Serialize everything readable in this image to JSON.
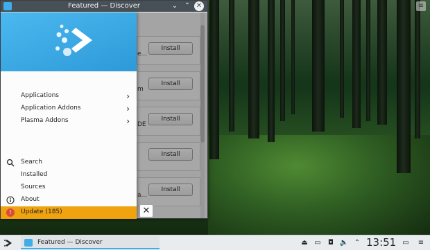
{
  "window": {
    "title": "Featured — Discover"
  },
  "content": {
    "cards": [
      {
        "fragment": "e...",
        "install_label": "Install"
      },
      {
        "fragment": "m",
        "install_label": "Install"
      },
      {
        "fragment": "DE",
        "install_label": "Install"
      },
      {
        "fragment": "",
        "install_label": "Install"
      },
      {
        "fragment": "a...",
        "install_label": "Install"
      }
    ]
  },
  "drawer": {
    "categories": [
      {
        "label": "Applications",
        "icon": "chevron-right-icon"
      },
      {
        "label": "Application Addons",
        "icon": "chevron-right-icon"
      },
      {
        "label": "Plasma Addons",
        "icon": "chevron-right-icon"
      }
    ],
    "actions": [
      {
        "label": "Search",
        "icon": "search-icon"
      },
      {
        "label": "Installed",
        "icon": ""
      },
      {
        "label": "Sources",
        "icon": ""
      },
      {
        "label": "About",
        "icon": "info-icon"
      },
      {
        "label": "Update (185)",
        "icon": "update-icon"
      }
    ],
    "colors": {
      "header": "#3daee9",
      "update_highlight": "#f0a20f"
    }
  },
  "taskbar": {
    "task_label": "Featured — Discover",
    "clock": "13:51"
  }
}
